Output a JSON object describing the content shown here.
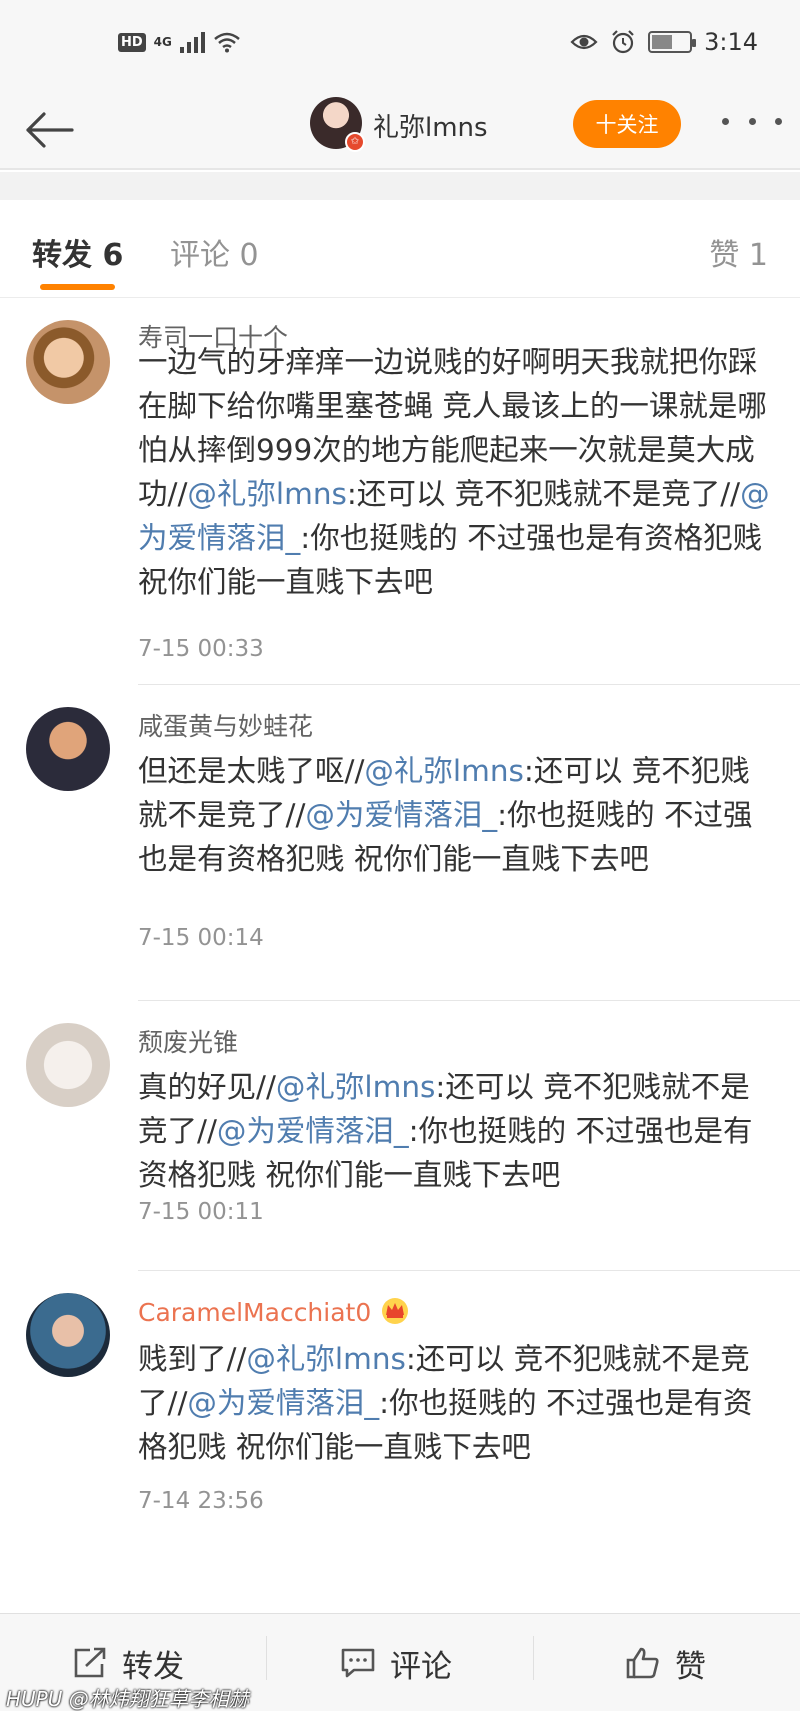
{
  "status_bar": {
    "hd": "HD",
    "network": "4G",
    "time": "3:14",
    "battery_level": 0.55
  },
  "header": {
    "username": "礼弥lmns",
    "follow_label": "十关注",
    "back_icon": "back-arrow-icon",
    "more_icon": "more-dots-icon"
  },
  "tabs": {
    "repost": "转发 6",
    "comment": "评论 0",
    "like": "赞 1",
    "active_color": "#ff8200"
  },
  "reposts": [
    {
      "name": "寿司一口十个",
      "text_a": "一边气的牙痒痒一边说贱的好啊明天我就把你踩在脚下给你嘴里塞苍蝇 竞人最该上的一课就是哪怕从摔倒999次的地方能爬起来一次就是莫大成功//",
      "mention1": "@礼弥lmns",
      "text_b": ":还可以 竞不犯贱就不是竞了//",
      "mention2": "@为爱情落泪_",
      "text_c": ":你也挺贱的   不过强也是有资格犯贱  祝你们能一直贱下去吧",
      "time": "7-15 00:33"
    },
    {
      "name": "咸蛋黄与妙蛙花",
      "text_a": "但还是太贱了呕//",
      "mention1": "@礼弥lmns",
      "text_b": ":还可以 竞不犯贱就不是竞了//",
      "mention2": "@为爱情落泪_",
      "text_c": ":你也挺贱的   不过强也是有资格犯贱  祝你们能一直贱下去吧",
      "time": "7-15 00:14"
    },
    {
      "name": "颓废光锥",
      "text_a": "真的好见//",
      "mention1": "@礼弥lmns",
      "text_b": ":还可以 竞不犯贱就不是竞了//",
      "mention2": "@为爱情落泪_",
      "text_c": ":你也挺贱的   不过强也是有资格犯贱  祝你们能一直贱下去吧",
      "time": "7-15 00:11"
    },
    {
      "name": "CaramelMacchiat0",
      "text_a": "贱到了//",
      "mention1": "@礼弥lmns",
      "text_b": ":还可以 竞不犯贱就不是竞了//",
      "mention2": "@为爱情落泪_",
      "text_c": ":你也挺贱的   不过强也是有资格犯贱  祝你们能一直贱下去吧",
      "time": "7-14 23:56"
    }
  ],
  "bottom_bar": {
    "repost": "转发",
    "comment": "评论",
    "like": "赞"
  },
  "watermark": "HUPU @林炜翔狂草李相赫",
  "colors": {
    "mention": "#507daf",
    "vip_name": "#eb7350"
  }
}
